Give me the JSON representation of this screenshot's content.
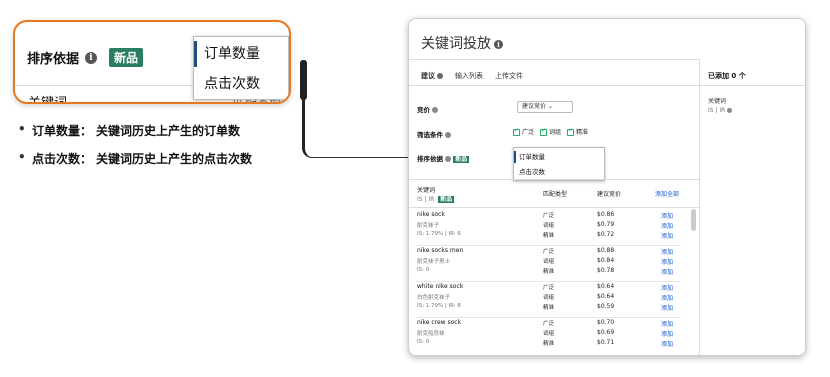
{
  "zoom": {
    "sort_label": "排序依据",
    "new_badge": "新品",
    "keyword_header": "关键词",
    "match_header_partial": "匹配类型",
    "menu_options": [
      "订单数量",
      "点击次数"
    ]
  },
  "bullets": [
    {
      "term": "订单数量：",
      "desc": "关键词历史上产生的订单数"
    },
    {
      "term": "点击次数：",
      "desc": "关键词历史上产生的点击次数"
    }
  ],
  "panel": {
    "title": "关键词投放",
    "tabs": [
      "建议",
      "输入列表",
      "上传文件"
    ],
    "added": "已添加 0 个",
    "side_kw": "关键词",
    "side_kw_sub": "IS | IR",
    "bid_label": "竞价",
    "bid_select": "建议竞价",
    "filter_label": "筛选条件",
    "filters": [
      "广泛",
      "词组",
      "精准"
    ],
    "sort_label": "排序依据",
    "new_badge": "新品",
    "menu_options": [
      "订单数量",
      "点击次数"
    ],
    "col_keyword": "关键词",
    "col_keyword_sub": "IS | IR",
    "col_match": "匹配类型",
    "col_bid": "建议竞价",
    "add_all": "添加全部",
    "add": "添加",
    "rows": [
      {
        "kw": "nike sock",
        "trans": "耐克袜子",
        "stat": "IS: 1.79% | IR: 6",
        "matches": [
          "广泛",
          "词组",
          "精准"
        ],
        "bids": [
          "$0.86",
          "$0.79",
          "$0.72"
        ]
      },
      {
        "kw": "nike socks men",
        "trans": "耐克袜子男士",
        "stat": "IS: 0",
        "matches": [
          "广泛",
          "词组",
          "精准"
        ],
        "bids": [
          "$0.88",
          "$0.84",
          "$0.78"
        ]
      },
      {
        "kw": "white nike sock",
        "trans": "白色耐克袜子",
        "stat": "IS: 1.79% | IR: 8",
        "matches": [
          "广泛",
          "词组",
          "精准"
        ],
        "bids": [
          "$0.64",
          "$0.64",
          "$0.59"
        ]
      },
      {
        "kw": "nike crew sock",
        "trans": "耐克船员袜",
        "stat": "IS: 0",
        "matches": [
          "广泛",
          "词组",
          "精准"
        ],
        "bids": [
          "$0.70",
          "$0.69",
          "$0.71"
        ]
      }
    ]
  }
}
